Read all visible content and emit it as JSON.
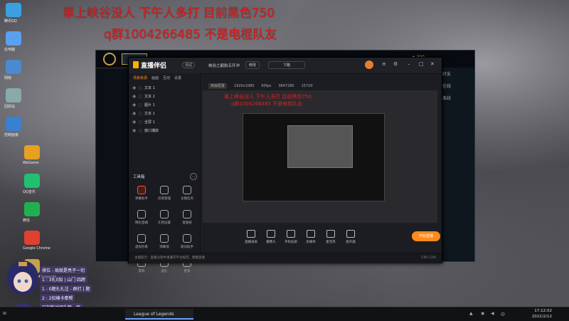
{
  "overlay": {
    "line1": "單上峡谷没人  下午人多打 目前黑色750",
    "line2": "q群1004266485  不是电棍队友"
  },
  "desktop_icons": [
    {
      "label": "腾讯QQ",
      "color": "#3aa0e0"
    },
    {
      "label": "此电脑",
      "color": "#5aa0f0"
    },
    {
      "label": "网络",
      "color": "#4a8ad0"
    },
    {
      "label": "回收站",
      "color": "#8aa"
    },
    {
      "label": "控制面板",
      "color": "#3a80d0"
    },
    {
      "label": "WeGame",
      "color": "#e8a020"
    },
    {
      "label": "QQ音乐",
      "color": "#20c070"
    },
    {
      "label": "微信",
      "color": "#20b050"
    },
    {
      "label": "Google Chrome",
      "color": "#e04030"
    },
    {
      "label": "League of Legends",
      "color": "#c8a04a"
    }
  ],
  "lol": {
    "rp": "300",
    "right_items": [
      "好友",
      "在线",
      "离线"
    ]
  },
  "tool": {
    "brand": "直播伴侣",
    "badge": "测试",
    "stream_title": "峡谷之巅航五开冲",
    "edit_label": "修改",
    "game_label": "下路",
    "sub_tabs": [
      "高级配置",
      "1920x1080",
      "60fps",
      "3847280",
      "15720"
    ],
    "left_tabs": [
      "场景来源",
      "画面",
      "互动",
      "设置"
    ],
    "sources": [
      "文本 1",
      "文本 2",
      "图片 1",
      "文本 1",
      "全屏 1",
      "窗口捕获"
    ],
    "tools_header": "工具箱",
    "tools": [
      {
        "label": "弹幕助手",
        "hot": true
      },
      {
        "label": "房管管理",
        "hot": false
      },
      {
        "label": "主播任务",
        "hot": false
      },
      {
        "label": "精彩直播",
        "hot": false
      },
      {
        "label": "礼物设置",
        "hot": false
      },
      {
        "label": "直播榜",
        "hot": false
      },
      {
        "label": "虚拟形象",
        "hot": false
      },
      {
        "label": "弹幕墙",
        "hot": false
      },
      {
        "label": "歌词助手",
        "hot": false
      },
      {
        "label": "游戏",
        "hot": false
      },
      {
        "label": "送礼",
        "hot": false
      },
      {
        "label": "更多",
        "hot": false
      }
    ],
    "bottom_buttons": [
      "直播录屏",
      "摄像头",
      "手机投屏",
      "多媒体",
      "麦克风",
      "扬声器"
    ],
    "start_label": "开始直播",
    "status_left": "主播提示：直播过程中请遵守平台规范，健康直播",
    "status_right": "CPU 13%",
    "preview_red_1": "單上峡谷没人  下午人多打 目前黑色750",
    "preview_red_2": "q群1004266485  不是电棍队友"
  },
  "chat": [
    "排位 - 局就是亮子一切",
    "1 : 3扎0加 | 山门 四跨",
    "1 - 0题扎扎注 - 群打 | 题",
    "2 : 2扣棉卡牵帮",
    "已加粉丝团礼物 - 强"
  ],
  "taskbar": {
    "app": "League of Legends",
    "time": "17:12:02",
    "date": "2022/2/12"
  }
}
